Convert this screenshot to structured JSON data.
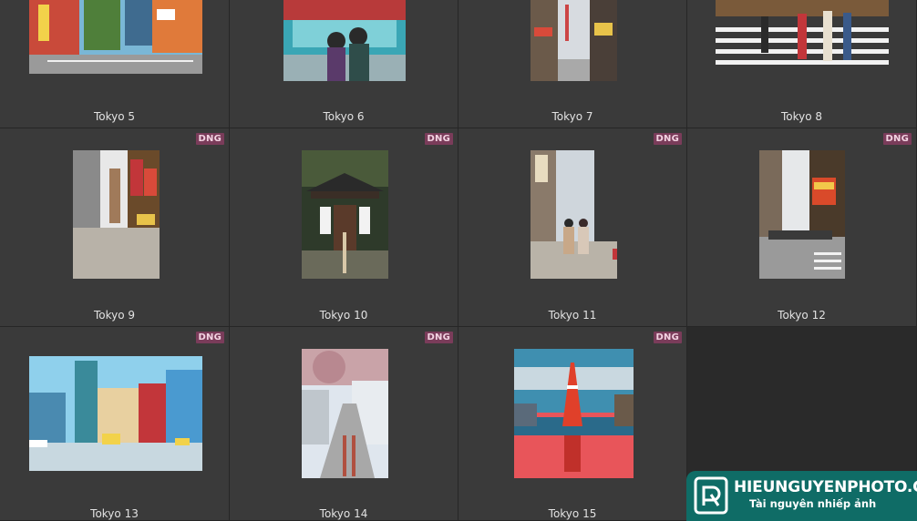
{
  "thumbnails": [
    {
      "name": "Tokyo 5",
      "badge": ""
    },
    {
      "name": "Tokyo 6",
      "badge": ""
    },
    {
      "name": "Tokyo 7",
      "badge": ""
    },
    {
      "name": "Tokyo 8",
      "badge": ""
    },
    {
      "name": "Tokyo 9",
      "badge": "DNG"
    },
    {
      "name": "Tokyo 10",
      "badge": "DNG"
    },
    {
      "name": "Tokyo 11",
      "badge": "DNG"
    },
    {
      "name": "Tokyo 12",
      "badge": "DNG"
    },
    {
      "name": "Tokyo 13",
      "badge": "DNG"
    },
    {
      "name": "Tokyo 14",
      "badge": "DNG"
    },
    {
      "name": "Tokyo 15",
      "badge": "DNG"
    }
  ],
  "watermark": {
    "brand": "HIEUNGUYENPHOTO.COM",
    "tagline": "Tài nguyên nhiếp ảnh"
  },
  "colors": {
    "badge_bg": "#7a3c5a",
    "cell_bg": "#3a3a3a",
    "watermark_bg": "#0f6c66"
  }
}
